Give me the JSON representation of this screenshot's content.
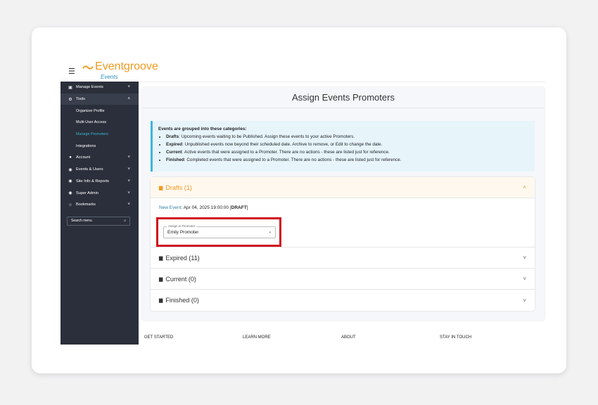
{
  "header": {
    "menu_icon": "hamburger-icon",
    "logo_name": "Eventgroove",
    "logo_sub": "Events"
  },
  "sidebar": {
    "items": [
      {
        "label": "Manage Events",
        "icon": "calendar-icon",
        "chevron": "˅"
      },
      {
        "label": "Tools",
        "icon": "gear-icon",
        "chevron": "˄"
      },
      {
        "label": "Organizer Profile"
      },
      {
        "label": "Multi-User Access"
      },
      {
        "label": "Manage Promoters"
      },
      {
        "label": "Integrations"
      },
      {
        "label": "Account",
        "icon": "user-circle-icon",
        "chevron": "˅"
      },
      {
        "label": "Events & Users",
        "icon": "users-icon",
        "chevron": "˅"
      },
      {
        "label": "Site Info & Reports",
        "icon": "chart-icon",
        "chevron": "˅"
      },
      {
        "label": "Super Admin",
        "icon": "admin-icon",
        "chevron": "˅"
      },
      {
        "label": "Bookmarks",
        "icon": "star-icon",
        "chevron": "˅"
      }
    ],
    "search_placeholder": "Search menu",
    "search_icon": "🔍"
  },
  "main": {
    "title": "Assign Events Promoters",
    "info": {
      "heading": "Events are grouped into these categories:",
      "bullets": [
        {
          "term": "Drafts",
          "text": ": Upcoming events waiting to be Published. Assign these events to your active Promoters."
        },
        {
          "term": "Expired",
          "text": ": Unpublished events now beyond their scheduled date. Archive to remove, or Edit to change the date."
        },
        {
          "term": "Current",
          "text": ": Active events that were assigned to a Promoter. There are no actions - these are listed just for reference."
        },
        {
          "term": "Finished",
          "text": ": Completed events that were assigned to a Promoter. There are no actions - these are listed just for reference."
        }
      ]
    },
    "sections": [
      {
        "label": "Drafts (1)",
        "chevron": "˄"
      },
      {
        "label": "Expired (11)",
        "chevron": "˅"
      },
      {
        "label": "Current (0)",
        "chevron": "˅"
      },
      {
        "label": "Finished (0)",
        "chevron": "˅"
      }
    ],
    "draft_event": {
      "link": "New Event",
      "date": ": Apr 04, 2025 19:00:00 [",
      "status": "DRAFT",
      "close": "]"
    },
    "assign": {
      "label": "Assign to Promoter",
      "value": "Emily Promoter"
    }
  },
  "footer": {
    "cols": [
      "GET STARTED",
      "LEARN MORE",
      "ABOUT",
      "STAY IN TOUCH"
    ]
  },
  "colors": {
    "brand_orange": "#f39a1f",
    "sidebar_bg": "#2b2f3b",
    "highlight_red": "#d0121c",
    "info_blue": "#3db5e0"
  }
}
